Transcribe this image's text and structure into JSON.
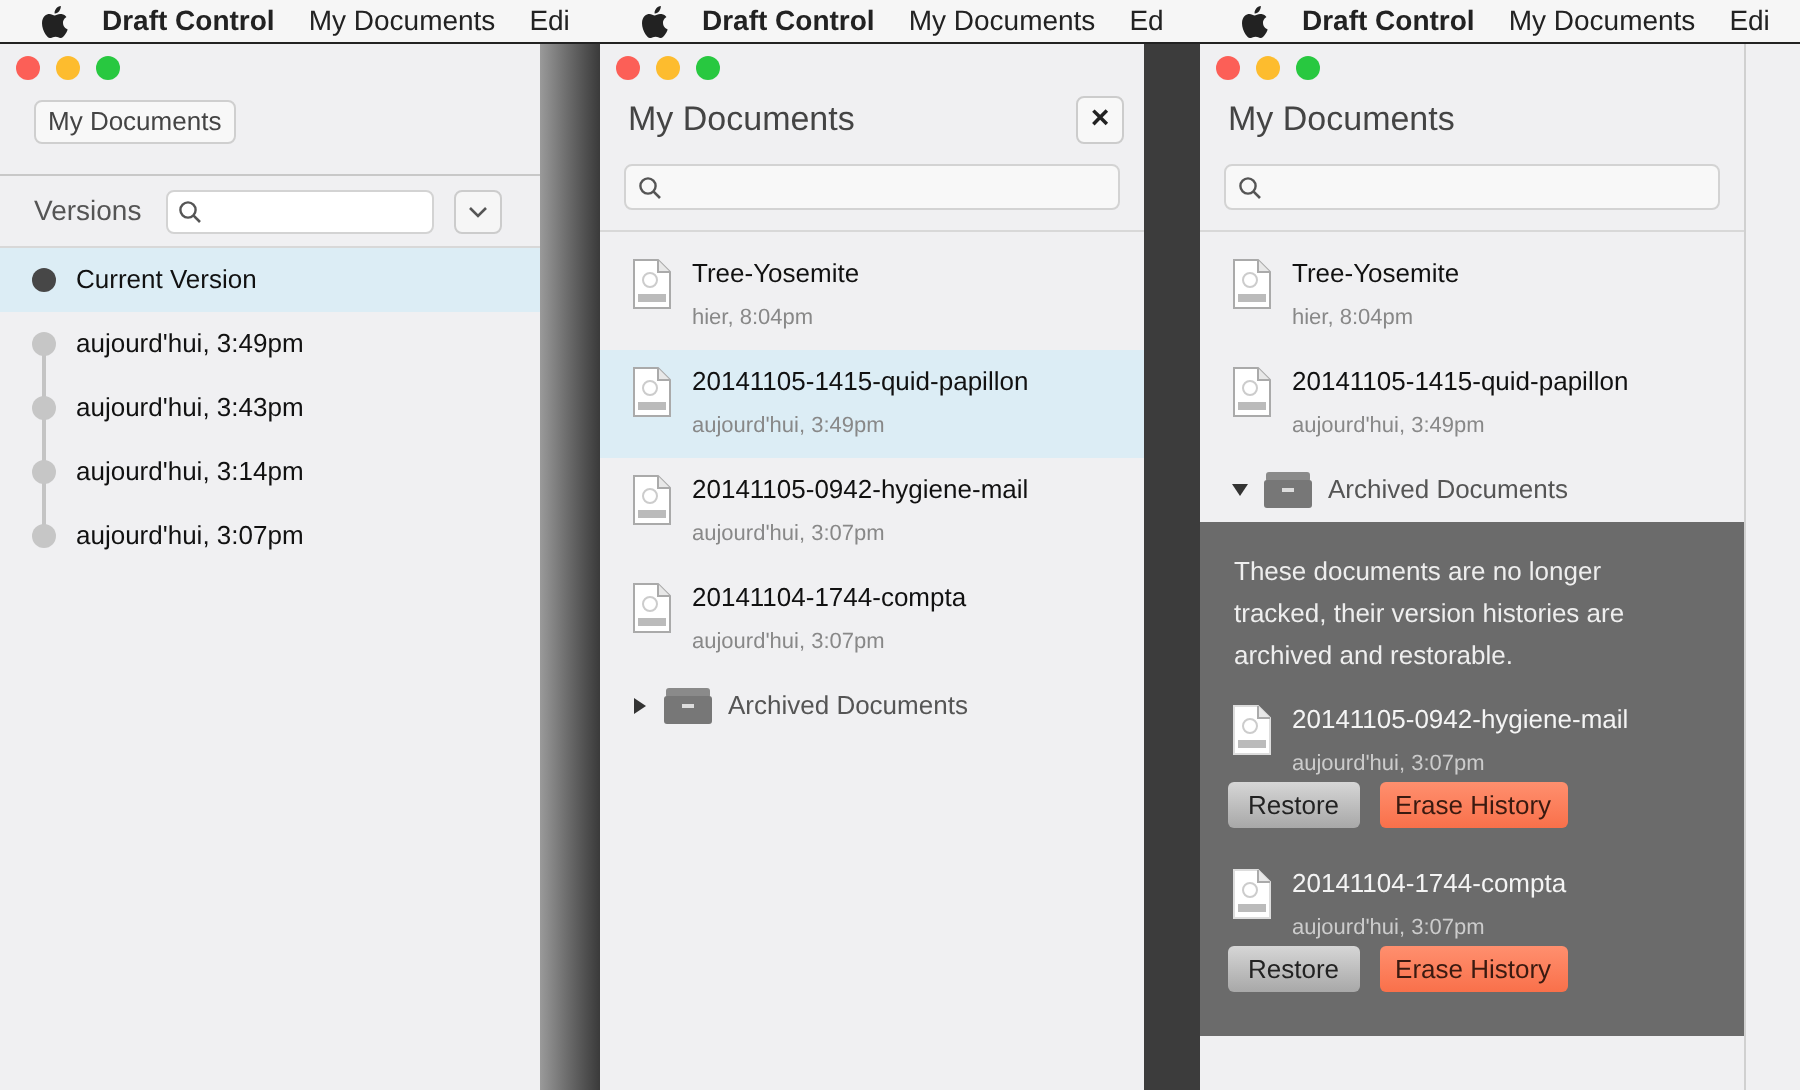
{
  "panels": [
    {
      "kind": "versions",
      "menu_bar": [
        "Draft Control",
        "My Documents",
        "Edi"
      ],
      "toolbar_button": "My Documents",
      "versions_label": "Versions",
      "versions": [
        {
          "label": "Current Version",
          "selected": true
        },
        {
          "label": "aujourd'hui, 3:49pm",
          "selected": false
        },
        {
          "label": "aujourd'hui, 3:43pm",
          "selected": false
        },
        {
          "label": "aujourd'hui, 3:14pm",
          "selected": false
        },
        {
          "label": "aujourd'hui, 3:07pm",
          "selected": false
        }
      ]
    },
    {
      "kind": "documents",
      "menu_bar": [
        "Draft Control",
        "My Documents",
        "Ed"
      ],
      "title": "My Documents",
      "close_button": "×",
      "documents": [
        {
          "name": "Tree-Yosemite",
          "date": "hier, 8:04pm",
          "selected": false
        },
        {
          "name": "20141105-1415-quid-papillon",
          "date": "aujourd'hui, 3:49pm",
          "selected": true
        },
        {
          "name": "20141105-0942-hygiene-mail",
          "date": "aujourd'hui, 3:07pm",
          "selected": false
        },
        {
          "name": "20141104-1744-compta",
          "date": "aujourd'hui, 3:07pm",
          "selected": false
        }
      ],
      "archived": {
        "label": "Archived Documents",
        "expanded": false
      }
    },
    {
      "kind": "documents",
      "menu_bar": [
        "Draft Control",
        "My Documents",
        "Edi"
      ],
      "title": "My Documents",
      "documents": [
        {
          "name": "Tree-Yosemite",
          "date": "hier, 8:04pm",
          "selected": false
        },
        {
          "name": "20141105-1415-quid-papillon",
          "date": "aujourd'hui, 3:49pm",
          "selected": false
        }
      ],
      "archived": {
        "label": "Archived Documents",
        "expanded": true,
        "note": "These documents are no longer tracked, their version histories are archived and restorable.",
        "items": [
          {
            "name": "20141105-0942-hygiene-mail",
            "date": "aujourd'hui, 3:07pm",
            "restore": "Restore",
            "erase": "Erase History"
          },
          {
            "name": "20141104-1744-compta",
            "date": "aujourd'hui, 3:07pm",
            "restore": "Restore",
            "erase": "Erase History"
          }
        ]
      }
    }
  ]
}
